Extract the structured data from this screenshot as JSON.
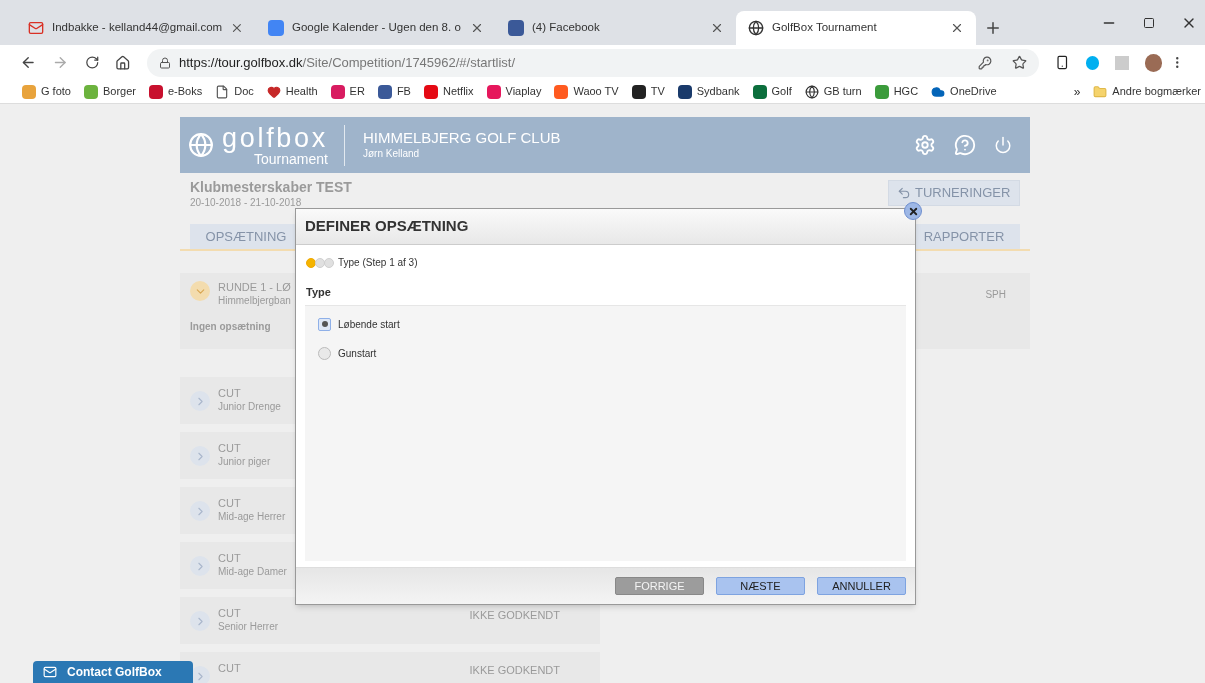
{
  "browser": {
    "tabs": [
      {
        "title": "Indbakke - kelland44@gmail.com",
        "selected": false
      },
      {
        "title": "Google Kalender - Ugen den 8. o",
        "selected": false
      },
      {
        "title": "(4) Facebook",
        "selected": false
      },
      {
        "title": "GolfBox Tournament",
        "selected": true
      }
    ],
    "url": {
      "host": "https://tour.golfbox.dk",
      "path": "/Site/Competition/1745962/#/startlist/"
    },
    "bookmarks": [
      "G foto",
      "Borger",
      "e-Boks",
      "Doc",
      "Health",
      "ER",
      "FB",
      "Netflix",
      "Viaplay",
      "Waoo TV",
      "TV",
      "Sydbank",
      "Golf",
      "GB turn",
      "HGC",
      "OneDrive"
    ],
    "more": "»",
    "other_bookmarks": "Andre bogmærker"
  },
  "header": {
    "logo": "golfbox",
    "logo_sub": "Tournament",
    "club": "HIMMELBJERG GOLF CLUB",
    "user": "Jørn Kelland"
  },
  "tournament": {
    "title": "Klubmesterskaber TEST",
    "dates": "20-10-2018 - 21-10-2018",
    "back_button": "TURNERINGER",
    "tabs": [
      {
        "label": "OPSÆTNING",
        "selected": false
      },
      {
        "label": "RAPPORTER",
        "selected": false
      }
    ]
  },
  "round": {
    "title": "RUNDE 1 - LØ",
    "course": "Himmelbjergban",
    "setup": "Ingen opsætning",
    "column": "SPH",
    "expanded": true
  },
  "cuts": [
    {
      "title": "CUT",
      "subtitle": "Junior Drenge"
    },
    {
      "title": "CUT",
      "subtitle": "Junior piger"
    },
    {
      "title": "CUT",
      "subtitle": "Mid-age Herrer"
    },
    {
      "title": "CUT",
      "subtitle": "Mid-age Damer"
    },
    {
      "title": "CUT",
      "subtitle": "Senior Herrer",
      "status": "IKKE GODKENDT"
    },
    {
      "title": "CUT",
      "status": "IKKE GODKENDT"
    }
  ],
  "contact_button": "Contact GolfBox",
  "dialog": {
    "title": "DEFINER OPSÆTNING",
    "steps": [
      {
        "active": true
      },
      {
        "active": false
      },
      {
        "active": false
      }
    ],
    "step_label": "Type (Step 1 af 3)",
    "section": "Type",
    "options": [
      {
        "label": "Løbende start",
        "selected": true
      },
      {
        "label": "Gunstart",
        "selected": false
      }
    ],
    "buttons": [
      {
        "label": "FORRIGE",
        "disabled": true
      },
      {
        "label": "NÆSTE",
        "disabled": false
      },
      {
        "label": "ANNULLER",
        "disabled": false
      }
    ]
  }
}
